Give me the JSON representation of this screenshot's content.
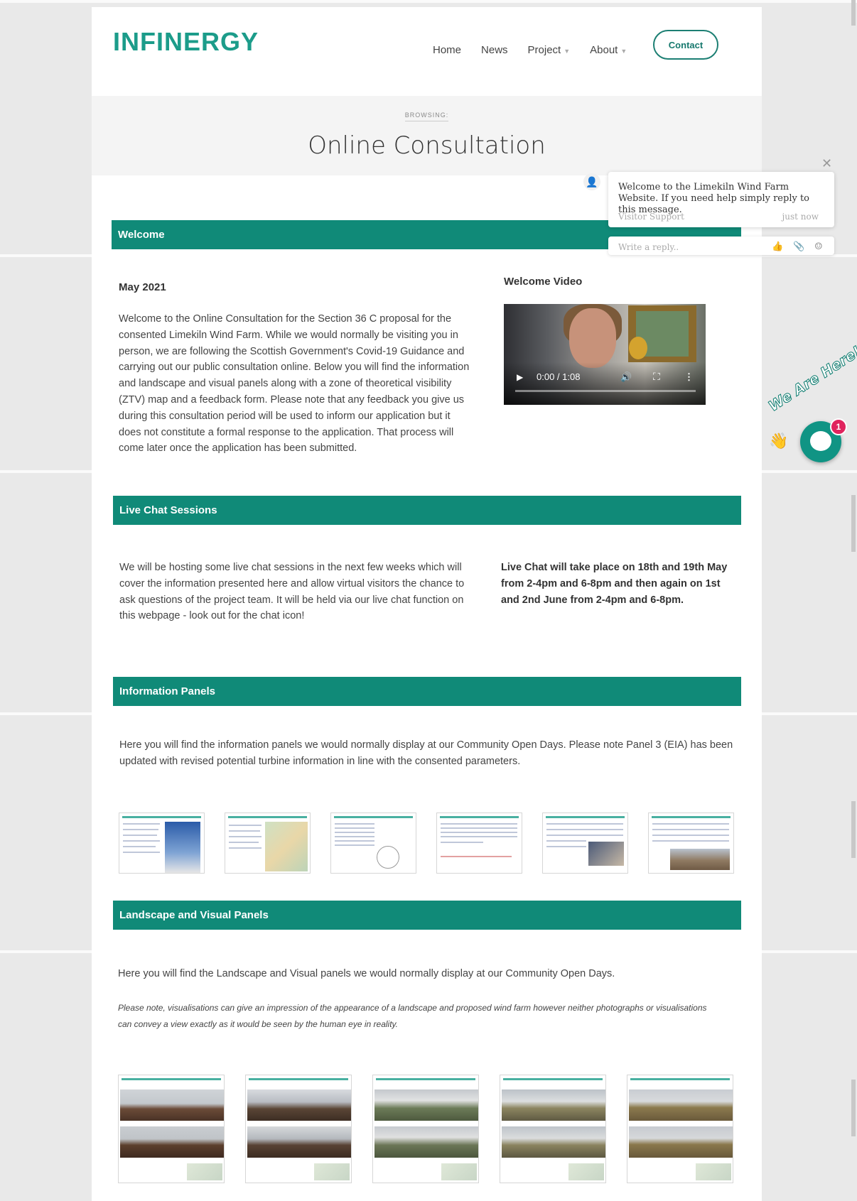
{
  "brand": {
    "logo": "INFINERGY",
    "accent": "#1c9c8a",
    "section_color": "#108a78"
  },
  "nav": {
    "items": [
      {
        "label": "Home",
        "has_menu": false
      },
      {
        "label": "News",
        "has_menu": false
      },
      {
        "label": "Project",
        "has_menu": true
      },
      {
        "label": "About",
        "has_menu": true
      }
    ],
    "contact_label": "Contact"
  },
  "hero": {
    "eyebrow": "BROWSING:",
    "title": "Online Consultation"
  },
  "welcome": {
    "heading": "Welcome",
    "date": "May 2021",
    "body": "Welcome to the Online Consultation for the Section 36 C proposal for the consented Limekiln Wind Farm. While we would normally be visiting you in person, we are following the Scottish Government's Covid-19 Guidance and carrying out our public consultation online.  Below you will find the information and landscape and visual panels along with a zone of theoretical visibility (ZTV) map and a feedback form.  Please note that any feedback you give us during this consultation period will be used to inform our application but it does not constitute a formal response to the application.  That process will come later once the application has been submitted.",
    "video_heading": "Welcome Video",
    "video_time": "0:00 / 1:08"
  },
  "live_chat": {
    "heading": "Live Chat Sessions",
    "body": "We will be hosting some live chat sessions in the next few weeks which will cover the information presented here and allow virtual visitors the chance to ask questions of the project team. It will be held via our live chat function on this webpage - look out for the chat icon!",
    "schedule": "Live Chat will take place on 18th and 19th May from 2-4pm and 6-8pm and then again on 1st and 2nd June from 2-4pm and 6-8pm."
  },
  "info_panels": {
    "heading": "Information Panels",
    "body": "Here you will find the information panels we would normally display at our Community Open Days. Please note Panel 3 (EIA) has been updated with revised potential turbine information in line with the consented parameters.",
    "thumbnail_count": 6
  },
  "lvia_panels": {
    "heading": "Landscape and Visual Panels",
    "body": "Here you will find the Landscape and Visual panels we would normally display at our Community Open Days.",
    "note": "Please note, visualisations can give an impression of the appearance of a landscape and proposed wind farm however neither photographs or visualisations can convey a view exactly as it would be seen by the human eye in reality.",
    "thumbnail_count": 5
  },
  "chat_widget": {
    "message": "Welcome to the Limekiln Wind Farm Website. If you need help simply reply to this message.",
    "sender": "Visitor Support",
    "time": "just now",
    "reply_placeholder": "Write a reply..",
    "launcher_text": "We Are Here!",
    "badge_count": "1"
  }
}
